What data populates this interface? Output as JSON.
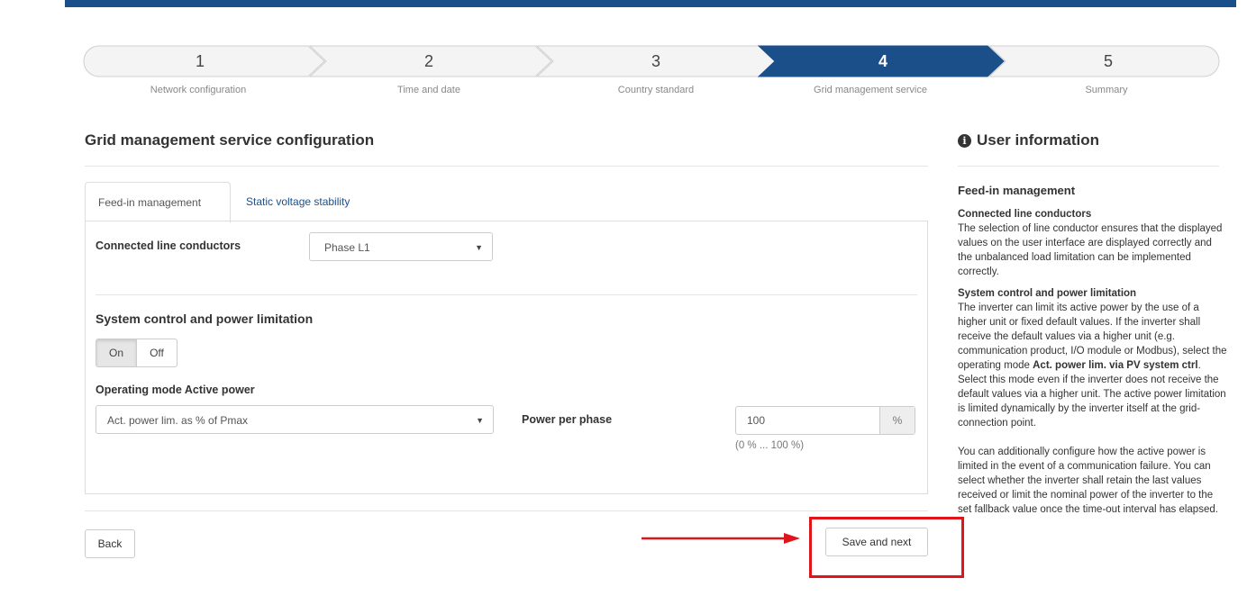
{
  "wizard": {
    "steps": [
      {
        "number": "1",
        "label": "Network configuration"
      },
      {
        "number": "2",
        "label": "Time and date"
      },
      {
        "number": "3",
        "label": "Country standard"
      },
      {
        "number": "4",
        "label": "Grid management service"
      },
      {
        "number": "5",
        "label": "Summary"
      }
    ],
    "active_step": 4
  },
  "page_title": "Grid management service configuration",
  "tabs": [
    {
      "label": "Feed-in management",
      "active": true
    },
    {
      "label": "Static voltage stability",
      "active": false
    }
  ],
  "form": {
    "line_conductors_label": "Connected line conductors",
    "line_conductors_value": "Phase L1",
    "system_control_heading": "System control and power limitation",
    "toggle_on": "On",
    "toggle_off": "Off",
    "operating_mode_label": "Operating mode Active power",
    "operating_mode_value": "Act. power lim. as % of Pmax",
    "power_per_phase_label": "Power per phase",
    "power_per_phase_value": "100",
    "power_per_phase_unit": "%",
    "power_per_phase_range": "(0 % ... 100 %)"
  },
  "buttons": {
    "back": "Back",
    "save_next": "Save and next"
  },
  "user_info": {
    "title": "User information",
    "section": "Feed-in management",
    "p1_title": "Connected line conductors",
    "p1_text": "The selection of line conductor ensures that the displayed values on the user interface are displayed correctly and the unbalanced load limitation can be implemented correctly.",
    "p2_title": "System control and power limitation",
    "p2_text_a": "The inverter can limit its active power by the use of a higher unit or fixed default values. If the inverter shall receive the default values via a higher unit (e.g. communication product, I/O module or Modbus), select the operating mode ",
    "p2_bold": "Act. power lim. via PV system ctrl",
    "p2_text_b": ". Select this mode even if the inverter does not receive the default values via a higher unit. The active power limitation is limited dynamically by the inverter itself at the grid-connection point.",
    "p3_text": "You can additionally configure how the active power is limited in the event of a communication failure. You can select whether the inverter shall retain the last values received or limit the nominal power of the inverter to the set fallback value once the time-out interval has elapsed."
  },
  "colors": {
    "brand": "#1b4f8a",
    "highlight": "#e0141b"
  }
}
